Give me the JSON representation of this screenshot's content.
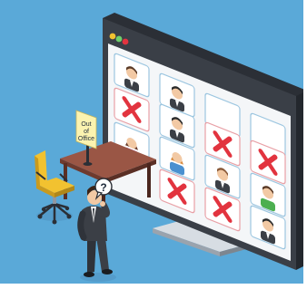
{
  "scene": {
    "colors": {
      "background": "#5aa9d8",
      "monitor_frame": "#3a3f47",
      "screen": "#f4f6f8",
      "tile_border_ok": "#9cc6e0",
      "tile_border_x": "#e8a0a6",
      "x_mark": "#e2343f",
      "desk_top": "#8a4b3c",
      "chair": "#f2c230",
      "suit": "#3b3f46"
    },
    "sign": {
      "line1": "Out",
      "line2": "of",
      "line3": "Office"
    },
    "speech": {
      "symbol": "?"
    },
    "window_buttons": [
      "#f2c230",
      "#6fd06a",
      "#e2343f"
    ],
    "tiles": [
      {
        "kind": "avatar",
        "icon": "male-avatar-icon"
      },
      {
        "kind": "avatar",
        "icon": "male-avatar-icon"
      },
      {
        "kind": "empty"
      },
      {
        "kind": "empty"
      },
      {
        "kind": "x",
        "icon": "x-mark-icon"
      },
      {
        "kind": "avatar",
        "icon": "male-avatar-icon"
      },
      {
        "kind": "x",
        "icon": "x-mark-icon"
      },
      {
        "kind": "x",
        "icon": "x-mark-icon"
      },
      {
        "kind": "avatar",
        "icon": "female-avatar-icon"
      },
      {
        "kind": "avatar",
        "icon": "female-avatar-icon"
      },
      {
        "kind": "avatar",
        "icon": "male-avatar-icon"
      },
      {
        "kind": "avatar",
        "icon": "male-avatar-icon"
      },
      {
        "kind": "empty"
      },
      {
        "kind": "x",
        "icon": "x-mark-icon"
      },
      {
        "kind": "x",
        "icon": "x-mark-icon"
      },
      {
        "kind": "avatar",
        "icon": "male-avatar-icon"
      }
    ]
  }
}
